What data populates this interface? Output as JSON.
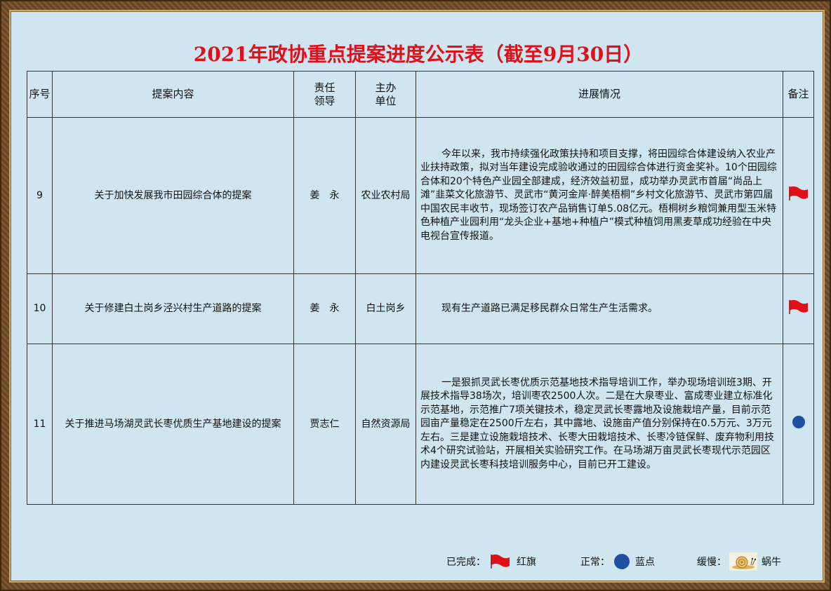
{
  "title": "2021年政协重点提案进度公示表（截至9月30日）",
  "headers": {
    "seq": "序号",
    "content": "提案内容",
    "leader_line1": "责任",
    "leader_line2": "领导",
    "unit_line1": "主办",
    "unit_line2": "单位",
    "progress": "进展情况",
    "note": "备注"
  },
  "rows": [
    {
      "seq": "9",
      "content": "关于加快发展我市田园综合体的提案",
      "leader": "姜　永",
      "unit": "农业农村局",
      "progress": "今年以来，我市持续强化政策扶持和项目支撑，将田园综合体建设纳入农业产业扶持政策，拟对当年建设完成验收通过的田园综合体进行资金奖补。10个田园综合体和20个特色产业园全部建成，经济效益初显，成功举办灵武市首届“尚品上滩”韭菜文化旅游节、灵武市“黄河金岸·醉美梧桐”乡村文化旅游节、灵武市第四届中国农民丰收节，现场签订农产品销售订单5.08亿元。梧桐树乡粮饲兼用型玉米特色种植产业园利用“龙头企业+基地+种植户”模式种植饲用黑麦草成功经验在中央电视台宣传报道。",
      "status": "red-flag"
    },
    {
      "seq": "10",
      "content": "关于修建白土岗乡泾兴村生产道路的提案",
      "leader": "姜　永",
      "unit": "白土岗乡",
      "progress": "现有生产道路已满足移民群众日常生产生活需求。",
      "status": "red-flag"
    },
    {
      "seq": "11",
      "content": "关于推进马场湖灵武长枣优质生产基地建设的提案",
      "leader": "贾志仁",
      "unit": "自然资源局",
      "progress": "一是狠抓灵武长枣优质示范基地技术指导培训工作，举办现场培训班3期、开展技术指导38场次，培训枣农2500人次。二是在大泉枣业、富成枣业建立标准化示范基地，示范推广7项关键技术，稳定灵武长枣露地及设施栽培产量，目前示范园亩产量稳定在2500斤左右，其中露地、设施亩产值分别保持在0.5万元、3万元左右。三是建立设施栽培技术、长枣大田栽培技术、长枣冷链保鲜、废弃物利用技术4个研究试验站，开展相关实验研究工作。在马场湖万亩灵武长枣现代示范园区内建设灵武长枣科技培训服务中心，目前已开工建设。",
      "status": "blue-dot"
    }
  ],
  "legend": {
    "done_label": "已完成：",
    "done_text": "红旗",
    "normal_label": "正常：",
    "normal_text": "蓝点",
    "slow_label": "缓慢：",
    "slow_text": "蜗牛"
  },
  "colors": {
    "title": "#e0101a",
    "flag": "#e0101a",
    "dot": "#1f4fa0",
    "background": "#cfe6f0"
  }
}
